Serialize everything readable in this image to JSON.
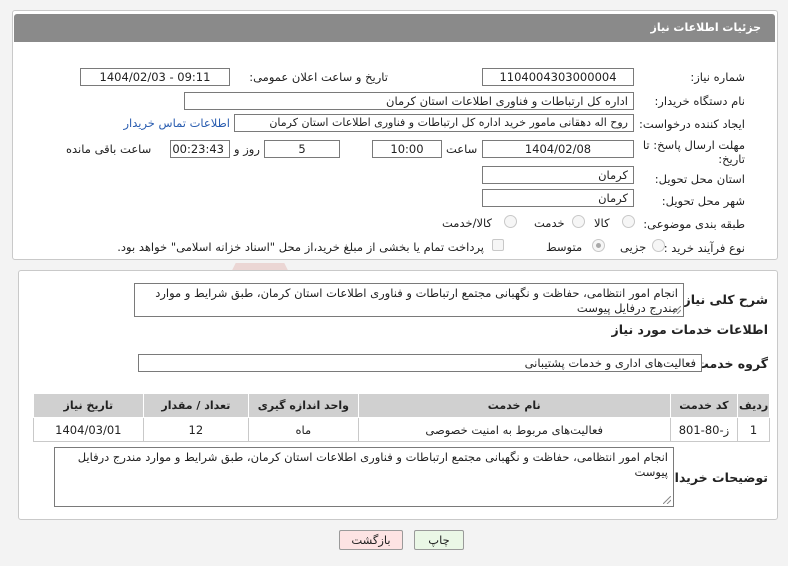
{
  "header": {
    "title": "جزئیات اطلاعات نیاز"
  },
  "fields": {
    "need_number_label": "شماره نیاز:",
    "need_number": "1104004303000004",
    "announce_label": "تاریخ و ساعت اعلان عمومی:",
    "announce_value": "1404/02/03 - 09:11",
    "buyer_org_label": "نام دستگاه خریدار:",
    "buyer_org": "اداره کل ارتباطات و فناوری اطلاعات استان کرمان",
    "creator_label": "ایجاد کننده درخواست:",
    "creator": "روح اله دهقانی مامور خرید اداره کل ارتباطات و فناوری اطلاعات استان کرمان",
    "contact_link": "اطلاعات تماس خریدار",
    "deadline_label_1": "مهلت ارسال پاسخ: تا",
    "deadline_label_2": "تاریخ:",
    "deadline_date": "1404/02/08",
    "time_label": "ساعت",
    "deadline_time": "10:00",
    "days_value": "5",
    "days_label": "روز و",
    "remaining_time": "00:23:43",
    "remaining_label": "ساعت باقی مانده",
    "province_label": "استان محل تحویل:",
    "province": "کرمان",
    "city_label": "شهر محل تحویل:",
    "city": "کرمان",
    "category_label": "طبقه بندی موضوعی:",
    "category_options": [
      "کالا",
      "خدمت",
      "کالا/خدمت"
    ],
    "process_label": "نوع فرآیند خرید :",
    "process_options": [
      "جزیی",
      "متوسط"
    ],
    "payment_note": "پرداخت تمام یا بخشی از مبلغ خرید،از محل \"اسناد خزانه اسلامی\" خواهد بود."
  },
  "description": {
    "label": "شرح کلی نیاز:",
    "text": "انجام امور انتظامی، حفاظت و نگهبانی مجتمع ارتباطات و فناوری اطلاعات استان کرمان، طبق شرایط و موارد مندرج درفایل پیوست"
  },
  "services": {
    "section_title": "اطلاعات خدمات مورد نیاز",
    "group_label": "گروه خدمت:",
    "group_value": "فعالیت‌های اداری و خدمات پشتیبانی",
    "columns": [
      "ردیف",
      "کد خدمت",
      "نام خدمت",
      "واحد اندازه گیری",
      "تعداد / مقدار",
      "تاریخ نیاز"
    ],
    "rows": [
      [
        "1",
        "ز-80-801",
        "فعالیت‌های مربوط به امنیت خصوصی",
        "ماه",
        "12",
        "1404/03/01"
      ]
    ]
  },
  "buyer_notes": {
    "label": "توضیحات خریدار:",
    "text": "انجام امور انتظامی، حفاظت و نگهبانی مجتمع ارتباطات و فناوری اطلاعات استان کرمان، طبق شرایط و موارد مندرج درفایل پیوست"
  },
  "buttons": {
    "print": "چاپ",
    "back": "بازگشت"
  },
  "colors": {
    "header_bg": "#8a8a8a",
    "link": "#2a5db0",
    "back_bg": "#fde3e3",
    "print_bg": "#eaf7e6"
  }
}
